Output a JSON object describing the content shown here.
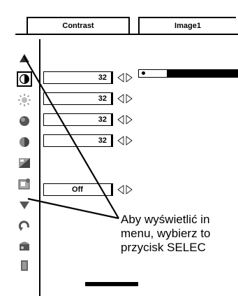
{
  "tabs": {
    "tab1_label": "Contrast",
    "tab2_label": "Image1"
  },
  "sidebar": {
    "icons": [
      "up-arrow-icon",
      "contrast-icon",
      "brightness-icon",
      "color-icon",
      "tint-icon",
      "color-temp-icon",
      "white-balance-icon",
      "down-arrow-icon",
      "reset-icon",
      "store-icon",
      "quit-icon"
    ]
  },
  "values": {
    "row1": "32",
    "row2": "32",
    "row3": "32",
    "row4": "32",
    "row5": "Off"
  },
  "slider": {
    "level_fraction": 0.15
  },
  "caption": {
    "line1": "Aby wyświetlić in",
    "line2": "menu, wybierz to",
    "line3": "przycisk SELEC"
  },
  "colors": {
    "ink": "#000000",
    "background": "#ffffff",
    "icon_gray": "#555555"
  }
}
